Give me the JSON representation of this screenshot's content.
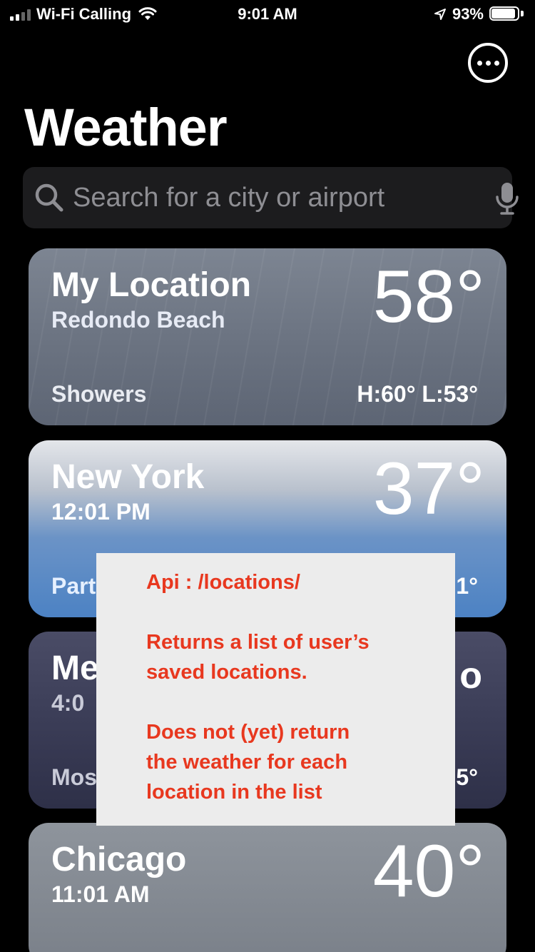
{
  "status_bar": {
    "carrier": "Wi-Fi Calling",
    "time": "9:01 AM",
    "battery_text": "93%",
    "battery_level": 0.93,
    "signal_bars": 2,
    "icons": [
      "wifi-icon",
      "location-arrow-icon",
      "battery-icon"
    ]
  },
  "header": {
    "title": "Weather",
    "more_icon": "ellipsis-circle-icon"
  },
  "search": {
    "placeholder": "Search for a city or airport",
    "left_icon": "search-icon",
    "right_icon": "microphone-icon"
  },
  "locations": [
    {
      "name": "My Location",
      "subtitle": "Redondo Beach",
      "temp": "58°",
      "condition": "Showers",
      "hilo": "H:60°  L:53°"
    },
    {
      "name": "New York",
      "subtitle": "12:01 PM",
      "temp": "37°",
      "condition": "Part",
      "hilo": "1°"
    },
    {
      "name": "Me",
      "subtitle": "4:0",
      "temp": "o",
      "condition": "Mos",
      "hilo": "5°"
    },
    {
      "name": "Chicago",
      "subtitle": "11:01 AM",
      "temp": "40°"
    }
  ],
  "note": {
    "line1": "Api : /locations/",
    "para2_line1": "Returns a list of user’s",
    "para2_line2": "saved locations.",
    "para3_line1": "Does not (yet) return",
    "para3_line2": "the weather for each",
    "para3_line3": "location in the list"
  },
  "colors": {
    "background": "#000000",
    "search_bg": "#1c1c1e",
    "placeholder": "#8e8e93",
    "note_bg": "#ececec",
    "note_text": "#e8381f"
  }
}
